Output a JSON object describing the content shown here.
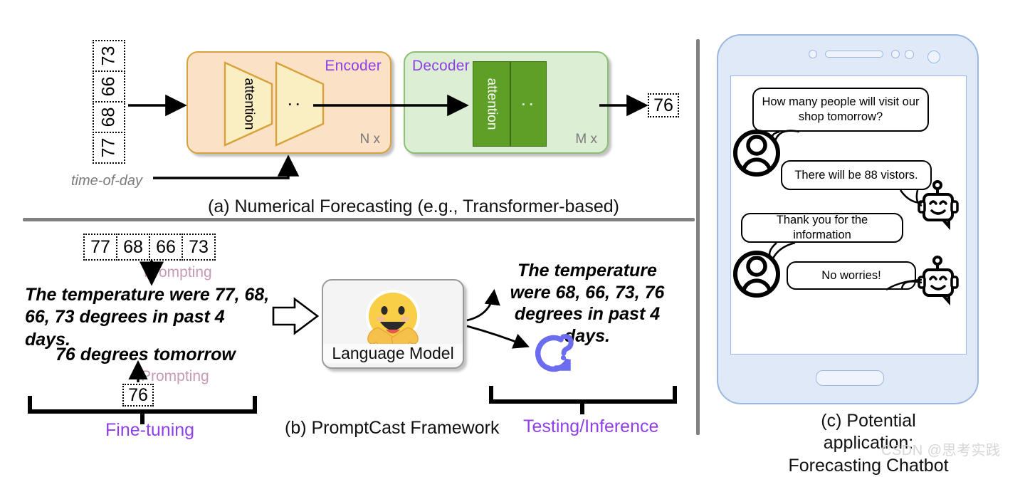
{
  "figure": {
    "panel_a": {
      "caption": "(a) Numerical Forecasting (e.g., Transformer-based)",
      "input_values": [
        "73",
        "66",
        "68",
        "77"
      ],
      "time_of_day_label": "time-of-day",
      "encoder": {
        "title": "Encoder",
        "repeat": "N x",
        "attention_label": "attention",
        "dots": ":"
      },
      "decoder": {
        "title": "Decoder",
        "repeat": "M x",
        "attention_label": "attention",
        "dots": ":"
      },
      "output_value": "76"
    },
    "panel_b": {
      "caption": "(b) PromptCast Framework",
      "sequence_values": [
        "77",
        "68",
        "66",
        "73"
      ],
      "prompting_label_1": "Prompting",
      "prompting_label_2": "Prompting",
      "prompt_sentence": "The temperature were 77, 68, 66, 73 degrees in past 4 days.",
      "answer_sentence": "76 degrees tomorrow",
      "finetune_value": "76",
      "finetune_label": "Fine-tuning",
      "language_model_label": "Language Model",
      "test_sentence": "The temperature were 68, 66, 73, 76 degrees in past 4 days.",
      "testing_label": "Testing/Inference"
    },
    "panel_c": {
      "caption_line1": "(c) Potential application:",
      "caption_line2": "Forecasting Chatbot",
      "messages": [
        {
          "speaker": "user",
          "text": "How many people will visit our shop tomorrow?"
        },
        {
          "speaker": "bot",
          "text": "There will be 88 vistors."
        },
        {
          "speaker": "user",
          "text": "Thank you for the information"
        },
        {
          "speaker": "bot",
          "text": "No worries!"
        }
      ]
    },
    "watermark": "CSDN @思考实践",
    "colors": {
      "encoder_fill": "#fbe1c6",
      "encoder_border": "#d9a13b",
      "decoder_fill": "#dceed4",
      "decoder_border": "#8cbf72",
      "attention_fill_encoder": "#faeec3",
      "attention_fill_decoder": "#5e9f25",
      "purple_label": "#8f3fe8",
      "prompting_label": "#c79ab5",
      "divider_gray": "#808080",
      "phone_body": "#dfe9f8",
      "phone_border": "#9bb8e0",
      "inference_icon": "#6c6cf0"
    }
  }
}
